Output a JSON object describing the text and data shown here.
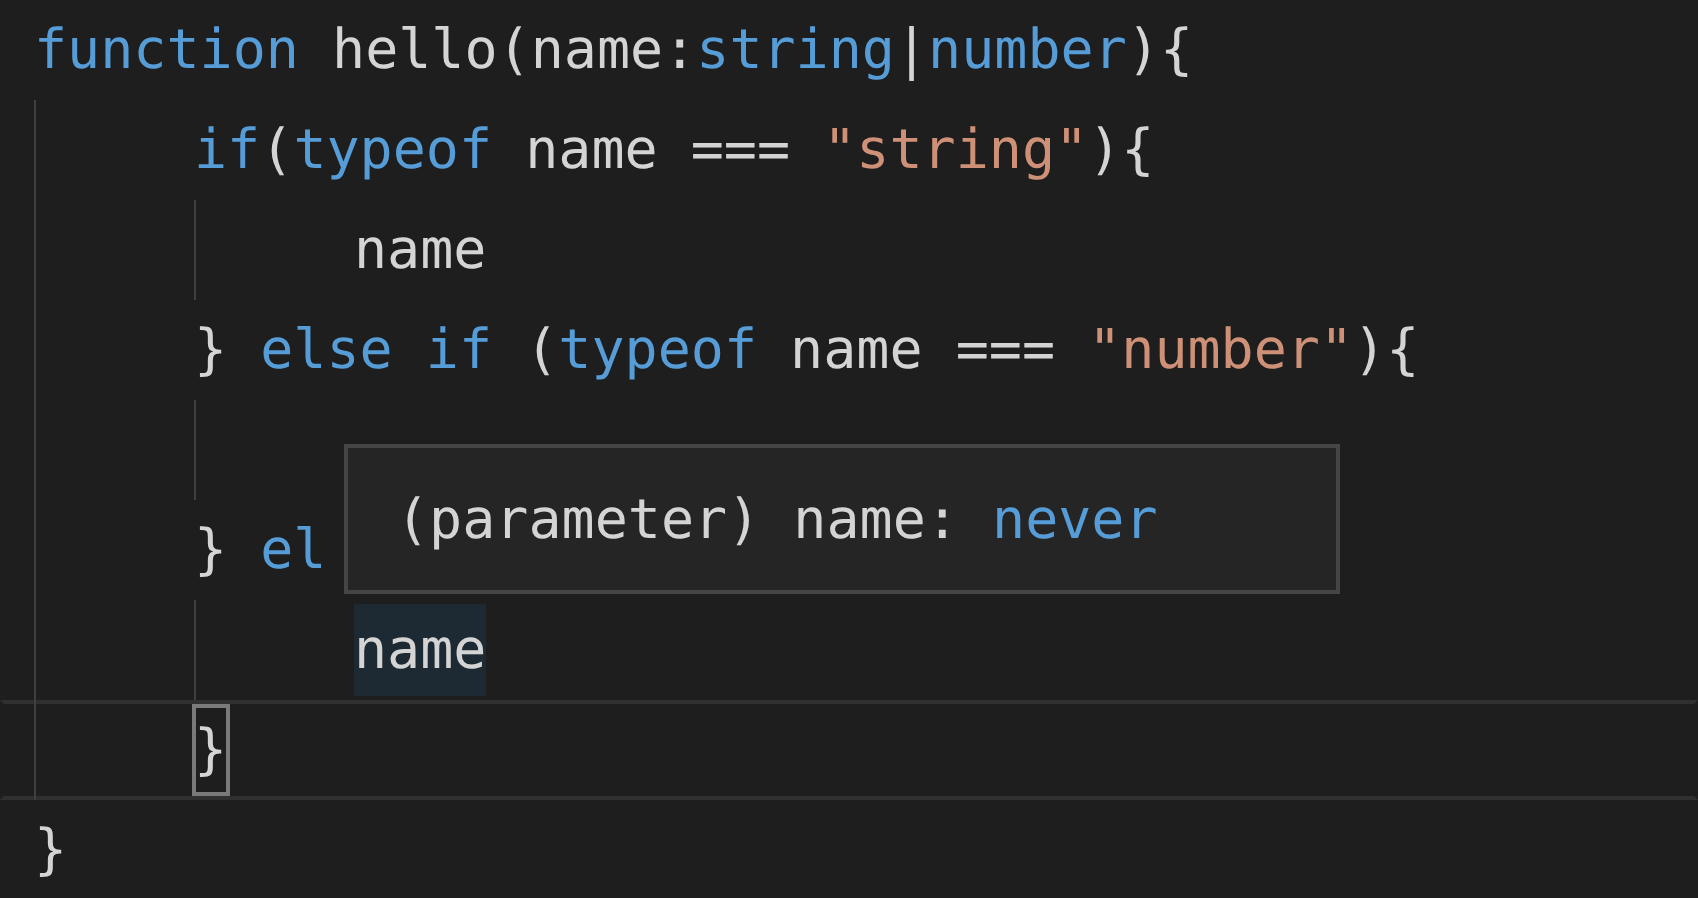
{
  "code": [
    {
      "current": false,
      "tokens": [
        {
          "text": "function",
          "kind": "keyword"
        },
        {
          "text": " hello(name:",
          "kind": "plain"
        },
        {
          "text": "string",
          "kind": "type"
        },
        {
          "text": "|",
          "kind": "plain"
        },
        {
          "text": "number",
          "kind": "type"
        },
        {
          "text": "){",
          "kind": "plain"
        }
      ],
      "children": [
        {
          "current": false,
          "tokens": [
            {
              "text": "if",
              "kind": "keyword"
            },
            {
              "text": "(",
              "kind": "plain"
            },
            {
              "text": "typeof",
              "kind": "keyword"
            },
            {
              "text": " name === ",
              "kind": "plain"
            },
            {
              "text": "\"string\"",
              "kind": "string"
            },
            {
              "text": "){",
              "kind": "plain"
            }
          ],
          "children": [
            {
              "current": false,
              "tokens": [
                {
                  "text": "name",
                  "kind": "plain"
                }
              ]
            }
          ]
        },
        {
          "current": false,
          "tokens": [
            {
              "text": "} ",
              "kind": "plain"
            },
            {
              "text": "else if",
              "kind": "keyword"
            },
            {
              "text": " (",
              "kind": "plain"
            },
            {
              "text": "typeof",
              "kind": "keyword"
            },
            {
              "text": " name === ",
              "kind": "plain"
            },
            {
              "text": "\"number\"",
              "kind": "string"
            },
            {
              "text": "){",
              "kind": "plain"
            }
          ],
          "children": [
            {
              "current": false
            }
          ]
        },
        {
          "current": false,
          "tokens": [
            {
              "text": "} ",
              "kind": "plain"
            },
            {
              "text": "el",
              "kind": "keyword"
            }
          ],
          "children": [
            {
              "current": false,
              "tokens": [
                {
                  "text": "name",
                  "kind": "highlight"
                }
              ]
            }
          ]
        },
        {
          "current": true,
          "tokens": [
            {
              "text": "}",
              "kind": "brace-match"
            }
          ]
        }
      ]
    },
    {
      "current": false,
      "tokens": [
        {
          "text": "}",
          "kind": "plain"
        }
      ]
    }
  ],
  "tooltip": {
    "parts": [
      {
        "text": "(parameter) name: ",
        "kind": "plain"
      },
      {
        "text": "never",
        "kind": "type"
      }
    ]
  }
}
